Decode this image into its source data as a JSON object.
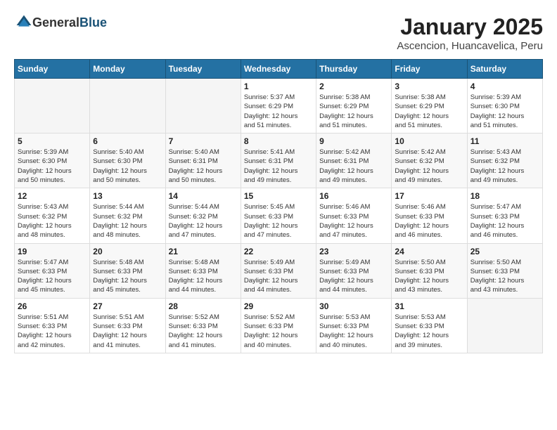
{
  "header": {
    "logo_general": "General",
    "logo_blue": "Blue",
    "month_year": "January 2025",
    "location": "Ascencion, Huancavelica, Peru"
  },
  "weekdays": [
    "Sunday",
    "Monday",
    "Tuesday",
    "Wednesday",
    "Thursday",
    "Friday",
    "Saturday"
  ],
  "weeks": [
    [
      {
        "day": "",
        "info": ""
      },
      {
        "day": "",
        "info": ""
      },
      {
        "day": "",
        "info": ""
      },
      {
        "day": "1",
        "info": "Sunrise: 5:37 AM\nSunset: 6:29 PM\nDaylight: 12 hours\nand 51 minutes."
      },
      {
        "day": "2",
        "info": "Sunrise: 5:38 AM\nSunset: 6:29 PM\nDaylight: 12 hours\nand 51 minutes."
      },
      {
        "day": "3",
        "info": "Sunrise: 5:38 AM\nSunset: 6:29 PM\nDaylight: 12 hours\nand 51 minutes."
      },
      {
        "day": "4",
        "info": "Sunrise: 5:39 AM\nSunset: 6:30 PM\nDaylight: 12 hours\nand 51 minutes."
      }
    ],
    [
      {
        "day": "5",
        "info": "Sunrise: 5:39 AM\nSunset: 6:30 PM\nDaylight: 12 hours\nand 50 minutes."
      },
      {
        "day": "6",
        "info": "Sunrise: 5:40 AM\nSunset: 6:30 PM\nDaylight: 12 hours\nand 50 minutes."
      },
      {
        "day": "7",
        "info": "Sunrise: 5:40 AM\nSunset: 6:31 PM\nDaylight: 12 hours\nand 50 minutes."
      },
      {
        "day": "8",
        "info": "Sunrise: 5:41 AM\nSunset: 6:31 PM\nDaylight: 12 hours\nand 49 minutes."
      },
      {
        "day": "9",
        "info": "Sunrise: 5:42 AM\nSunset: 6:31 PM\nDaylight: 12 hours\nand 49 minutes."
      },
      {
        "day": "10",
        "info": "Sunrise: 5:42 AM\nSunset: 6:32 PM\nDaylight: 12 hours\nand 49 minutes."
      },
      {
        "day": "11",
        "info": "Sunrise: 5:43 AM\nSunset: 6:32 PM\nDaylight: 12 hours\nand 49 minutes."
      }
    ],
    [
      {
        "day": "12",
        "info": "Sunrise: 5:43 AM\nSunset: 6:32 PM\nDaylight: 12 hours\nand 48 minutes."
      },
      {
        "day": "13",
        "info": "Sunrise: 5:44 AM\nSunset: 6:32 PM\nDaylight: 12 hours\nand 48 minutes."
      },
      {
        "day": "14",
        "info": "Sunrise: 5:44 AM\nSunset: 6:32 PM\nDaylight: 12 hours\nand 47 minutes."
      },
      {
        "day": "15",
        "info": "Sunrise: 5:45 AM\nSunset: 6:33 PM\nDaylight: 12 hours\nand 47 minutes."
      },
      {
        "day": "16",
        "info": "Sunrise: 5:46 AM\nSunset: 6:33 PM\nDaylight: 12 hours\nand 47 minutes."
      },
      {
        "day": "17",
        "info": "Sunrise: 5:46 AM\nSunset: 6:33 PM\nDaylight: 12 hours\nand 46 minutes."
      },
      {
        "day": "18",
        "info": "Sunrise: 5:47 AM\nSunset: 6:33 PM\nDaylight: 12 hours\nand 46 minutes."
      }
    ],
    [
      {
        "day": "19",
        "info": "Sunrise: 5:47 AM\nSunset: 6:33 PM\nDaylight: 12 hours\nand 45 minutes."
      },
      {
        "day": "20",
        "info": "Sunrise: 5:48 AM\nSunset: 6:33 PM\nDaylight: 12 hours\nand 45 minutes."
      },
      {
        "day": "21",
        "info": "Sunrise: 5:48 AM\nSunset: 6:33 PM\nDaylight: 12 hours\nand 44 minutes."
      },
      {
        "day": "22",
        "info": "Sunrise: 5:49 AM\nSunset: 6:33 PM\nDaylight: 12 hours\nand 44 minutes."
      },
      {
        "day": "23",
        "info": "Sunrise: 5:49 AM\nSunset: 6:33 PM\nDaylight: 12 hours\nand 44 minutes."
      },
      {
        "day": "24",
        "info": "Sunrise: 5:50 AM\nSunset: 6:33 PM\nDaylight: 12 hours\nand 43 minutes."
      },
      {
        "day": "25",
        "info": "Sunrise: 5:50 AM\nSunset: 6:33 PM\nDaylight: 12 hours\nand 43 minutes."
      }
    ],
    [
      {
        "day": "26",
        "info": "Sunrise: 5:51 AM\nSunset: 6:33 PM\nDaylight: 12 hours\nand 42 minutes."
      },
      {
        "day": "27",
        "info": "Sunrise: 5:51 AM\nSunset: 6:33 PM\nDaylight: 12 hours\nand 41 minutes."
      },
      {
        "day": "28",
        "info": "Sunrise: 5:52 AM\nSunset: 6:33 PM\nDaylight: 12 hours\nand 41 minutes."
      },
      {
        "day": "29",
        "info": "Sunrise: 5:52 AM\nSunset: 6:33 PM\nDaylight: 12 hours\nand 40 minutes."
      },
      {
        "day": "30",
        "info": "Sunrise: 5:53 AM\nSunset: 6:33 PM\nDaylight: 12 hours\nand 40 minutes."
      },
      {
        "day": "31",
        "info": "Sunrise: 5:53 AM\nSunset: 6:33 PM\nDaylight: 12 hours\nand 39 minutes."
      },
      {
        "day": "",
        "info": ""
      }
    ]
  ]
}
